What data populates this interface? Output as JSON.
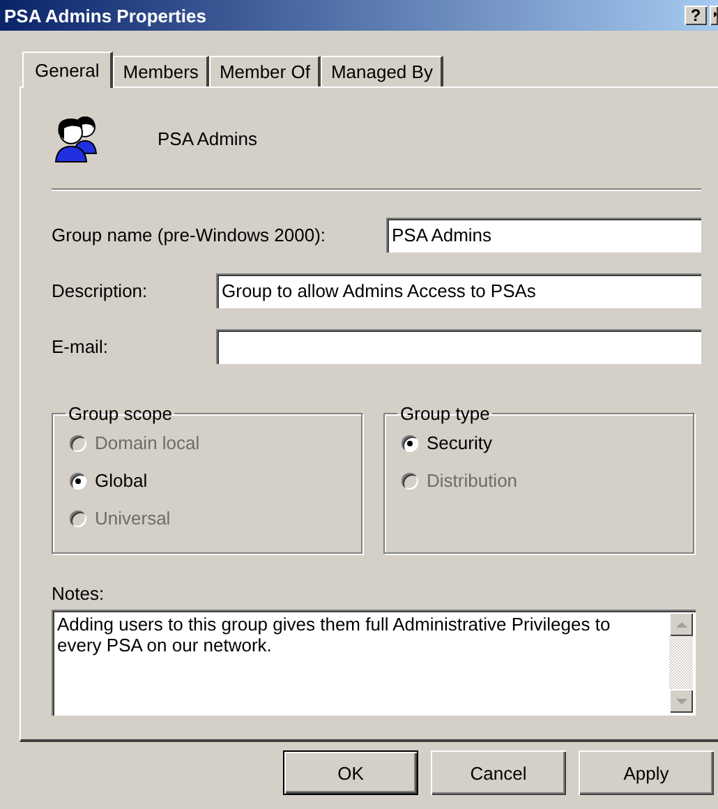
{
  "window": {
    "title": "PSA Admins Properties",
    "help_button": "?"
  },
  "tabs": [
    {
      "label": "General",
      "selected": true
    },
    {
      "label": "Members",
      "selected": false
    },
    {
      "label": "Member Of",
      "selected": false
    },
    {
      "label": "Managed By",
      "selected": false
    }
  ],
  "header": {
    "name": "PSA Admins"
  },
  "fields": [
    {
      "label": "Group name (pre-Windows 2000):",
      "value": "PSA Admins",
      "kind": "short"
    },
    {
      "label": "Description:",
      "value": "Group to allow Admins Access to PSAs",
      "kind": "long"
    },
    {
      "label": "E-mail:",
      "kind": "long"
    }
  ],
  "group_scope": {
    "title": "Group scope",
    "options": [
      {
        "label": "Domain local",
        "selected": false,
        "disabled": true
      },
      {
        "label": "Global",
        "selected": true,
        "disabled": false
      },
      {
        "label": "Universal",
        "selected": false,
        "disabled": true
      }
    ]
  },
  "group_type": {
    "title": "Group type",
    "options": [
      {
        "label": "Security",
        "selected": true,
        "disabled": false
      },
      {
        "label": "Distribution",
        "selected": false,
        "disabled": true
      }
    ]
  },
  "notes": {
    "label": "Notes:",
    "value": "Adding users to this group gives them full Administrative Privileges to every PSA on our network."
  },
  "buttons": [
    {
      "label": "OK",
      "default": true
    },
    {
      "label": "Cancel",
      "default": false
    },
    {
      "label": "Apply",
      "default": false
    }
  ]
}
